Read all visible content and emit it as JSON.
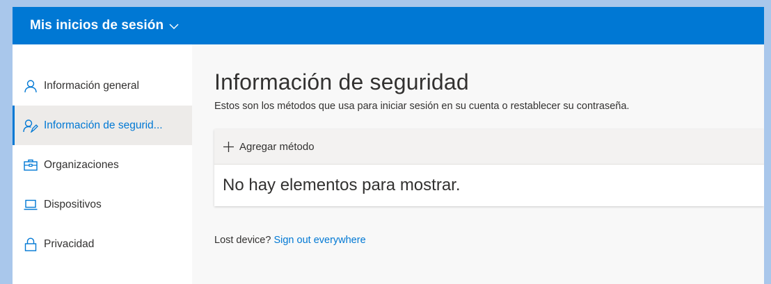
{
  "header": {
    "title": "Mis inicios de sesión",
    "chevron_icon": "chevron-down-icon"
  },
  "sidebar": {
    "items": [
      {
        "label": "Información general",
        "icon": "person-icon",
        "selected": false
      },
      {
        "label": "Información de segurid...",
        "icon": "security-info-icon",
        "selected": true
      },
      {
        "label": "Organizaciones",
        "icon": "briefcase-icon",
        "selected": false
      },
      {
        "label": "Dispositivos",
        "icon": "laptop-icon",
        "selected": false
      },
      {
        "label": "Privacidad",
        "icon": "lock-icon",
        "selected": false
      }
    ]
  },
  "main": {
    "title": "Información de seguridad",
    "subtitle": "Estos son los métodos que usa para iniciar sesión en su cuenta o restablecer su contraseña.",
    "add_method_label": "Agregar método",
    "empty_message": "No hay elementos para mostrar.",
    "lost_device_text": "Lost device?",
    "sign_out_link": "Sign out everywhere"
  },
  "colors": {
    "accent": "#0078d4",
    "page_background": "#a9c7eb",
    "selected_background": "#edebe9"
  }
}
